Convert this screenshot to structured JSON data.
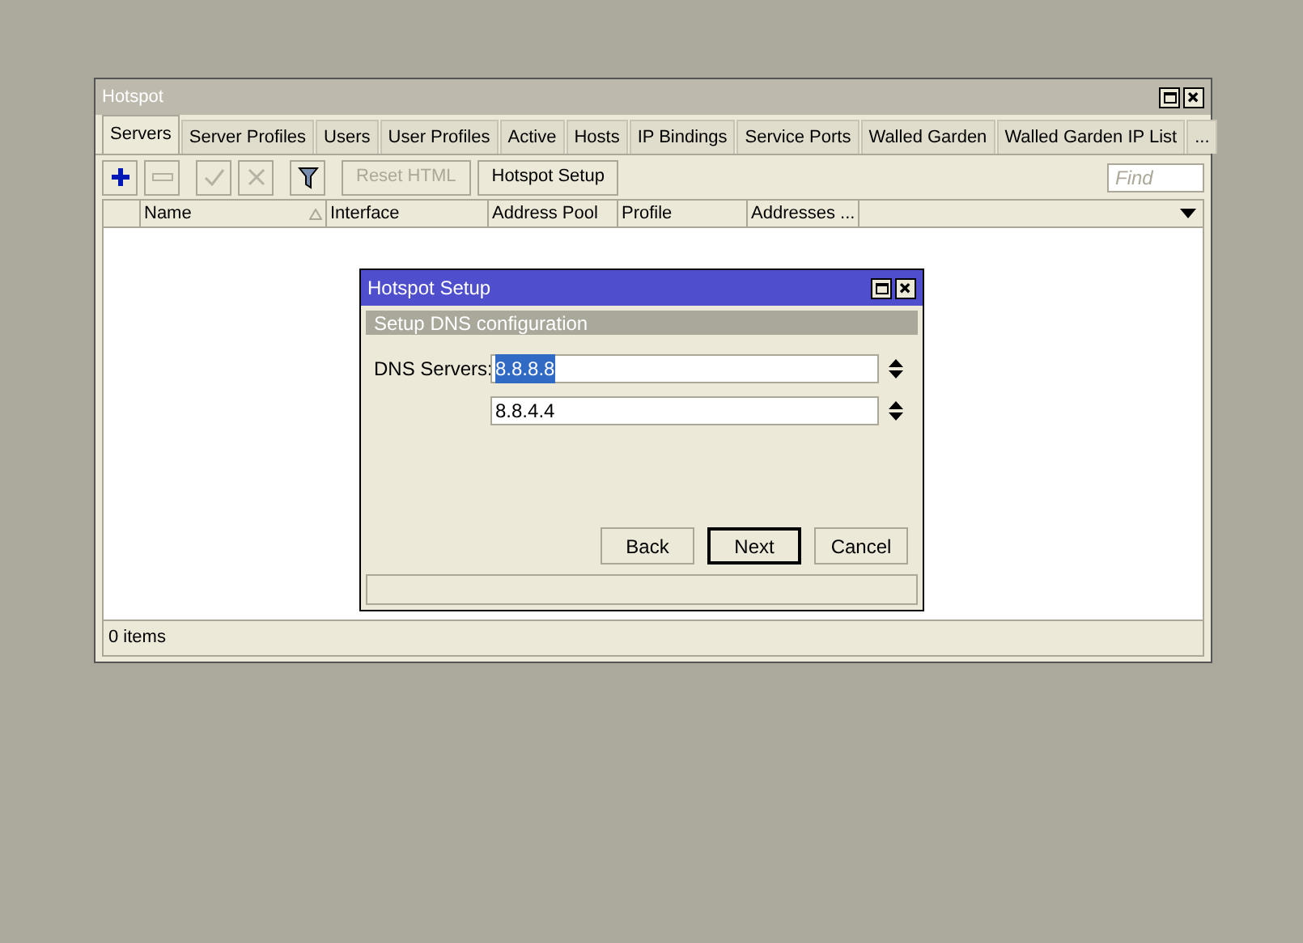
{
  "window": {
    "title": "Hotspot"
  },
  "tabs": [
    {
      "label": "Servers",
      "selected": true
    },
    {
      "label": "Server Profiles",
      "selected": false
    },
    {
      "label": "Users",
      "selected": false
    },
    {
      "label": "User Profiles",
      "selected": false
    },
    {
      "label": "Active",
      "selected": false
    },
    {
      "label": "Hosts",
      "selected": false
    },
    {
      "label": "IP Bindings",
      "selected": false
    },
    {
      "label": "Service Ports",
      "selected": false
    },
    {
      "label": "Walled Garden",
      "selected": false
    },
    {
      "label": "Walled Garden IP List",
      "selected": false
    },
    {
      "label": "...",
      "selected": false
    }
  ],
  "toolbar": [
    {
      "kind": "add",
      "disabled": false
    },
    {
      "kind": "remove",
      "disabled": true
    },
    {
      "kind": "check",
      "disabled": true
    },
    {
      "kind": "cross",
      "disabled": true
    },
    {
      "kind": "filter",
      "disabled": false
    },
    {
      "kind": "text",
      "label": "Reset HTML",
      "disabled": true
    },
    {
      "kind": "text",
      "label": "Hotspot Setup",
      "disabled": false
    }
  ],
  "search": {
    "placeholder": "Find"
  },
  "table": {
    "columns": [
      {
        "label": "Name",
        "sorted": true
      },
      {
        "label": "Interface",
        "sorted": false
      },
      {
        "label": "Address Pool",
        "sorted": false
      },
      {
        "label": "Profile",
        "sorted": false
      },
      {
        "label": "Addresses ...",
        "sorted": false
      }
    ]
  },
  "status_bar": "0 items",
  "dialog": {
    "title": "Hotspot Setup",
    "section": "Setup DNS configuration",
    "label": "DNS Servers:",
    "fields": [
      {
        "value": "8.8.8.8",
        "selected": true
      },
      {
        "value": "8.8.4.4",
        "selected": false
      }
    ],
    "buttons": [
      {
        "label": "Back",
        "default": false
      },
      {
        "label": "Next",
        "default": true
      },
      {
        "label": "Cancel",
        "default": false
      }
    ]
  }
}
